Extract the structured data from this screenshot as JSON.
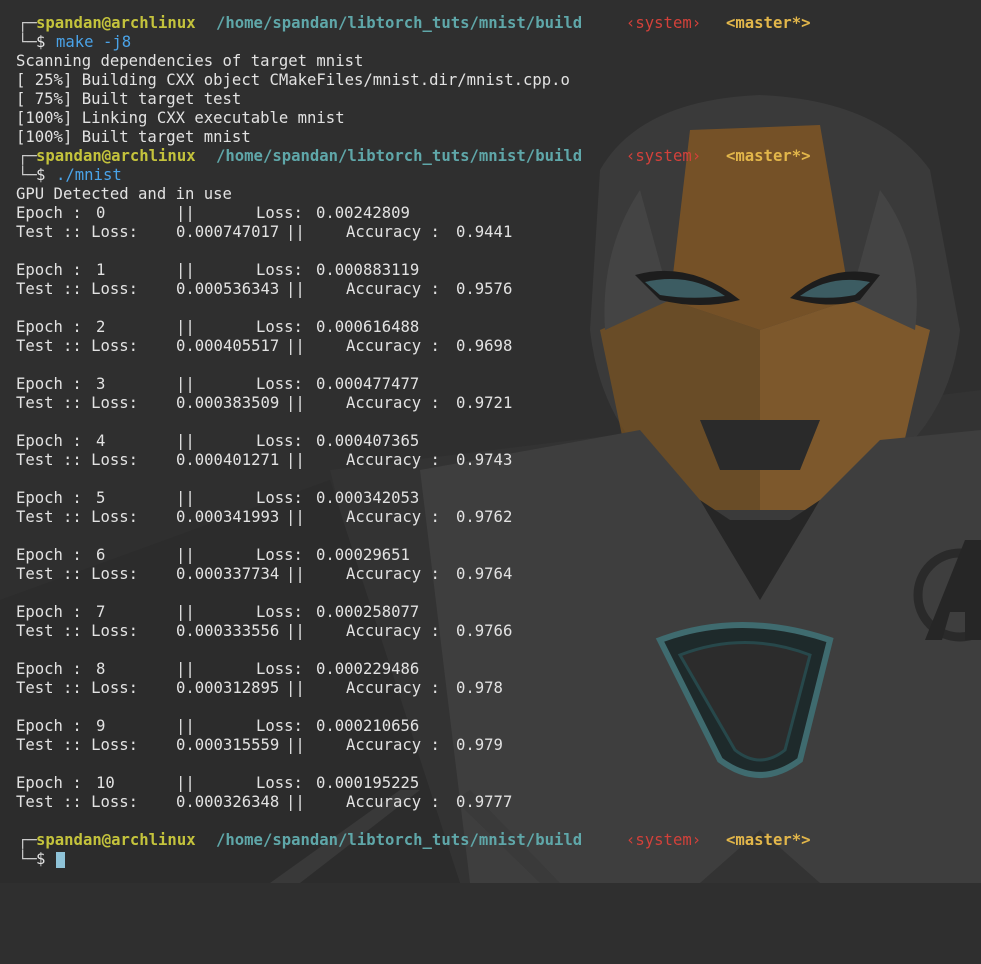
{
  "prompt": {
    "user_host": "spandan@archlinux",
    "path": "/home/spandan/libtorch_tuts/mnist/build",
    "system": "‹system›",
    "git": "<master*>",
    "symbol": "$"
  },
  "commands": [
    "make -j8",
    "./mnist"
  ],
  "build_output": [
    "Scanning dependencies of target mnist",
    "[ 25%] Building CXX object CMakeFiles/mnist.dir/mnist.cpp.o",
    "[ 75%] Built target test",
    "[100%] Linking CXX executable mnist",
    "[100%] Built target mnist"
  ],
  "run_header": "GPU Detected and in use",
  "epoch_label": "Epoch :",
  "sep": "||",
  "loss_label": "Loss:",
  "test_label": "Test :: Loss:",
  "acc_label": "Accuracy :",
  "epochs": [
    {
      "n": "0",
      "loss": "0.00242809",
      "test_loss": "0.000747017",
      "acc": "0.9441"
    },
    {
      "n": "1",
      "loss": "0.000883119",
      "test_loss": "0.000536343",
      "acc": "0.9576"
    },
    {
      "n": "2",
      "loss": "0.000616488",
      "test_loss": "0.000405517",
      "acc": "0.9698"
    },
    {
      "n": "3",
      "loss": "0.000477477",
      "test_loss": "0.000383509",
      "acc": "0.9721"
    },
    {
      "n": "4",
      "loss": "0.000407365",
      "test_loss": "0.000401271",
      "acc": "0.9743"
    },
    {
      "n": "5",
      "loss": "0.000342053",
      "test_loss": "0.000341993",
      "acc": "0.9762"
    },
    {
      "n": "6",
      "loss": "0.00029651",
      "test_loss": "0.000337734",
      "acc": "0.9764"
    },
    {
      "n": "7",
      "loss": "0.000258077",
      "test_loss": "0.000333556",
      "acc": "0.9766"
    },
    {
      "n": "8",
      "loss": "0.000229486",
      "test_loss": "0.000312895",
      "acc": "0.978"
    },
    {
      "n": "9",
      "loss": "0.000210656",
      "test_loss": "0.000315559",
      "acc": "0.979"
    },
    {
      "n": "10",
      "loss": "0.000195225",
      "test_loss": "0.000326348",
      "acc": "0.9777"
    }
  ],
  "colors": {
    "background": "#2f2f2f",
    "user_host": "#c4c33c",
    "path": "#5fa7a9",
    "system": "#d3413a",
    "git": "#e2b64a",
    "command": "#4aa3e8",
    "cursor": "#8fc3d8"
  },
  "wallpaper": {
    "icons": [
      "iron-man-helmet-icon",
      "arc-reactor-icon",
      "avengers-logo-icon"
    ]
  }
}
